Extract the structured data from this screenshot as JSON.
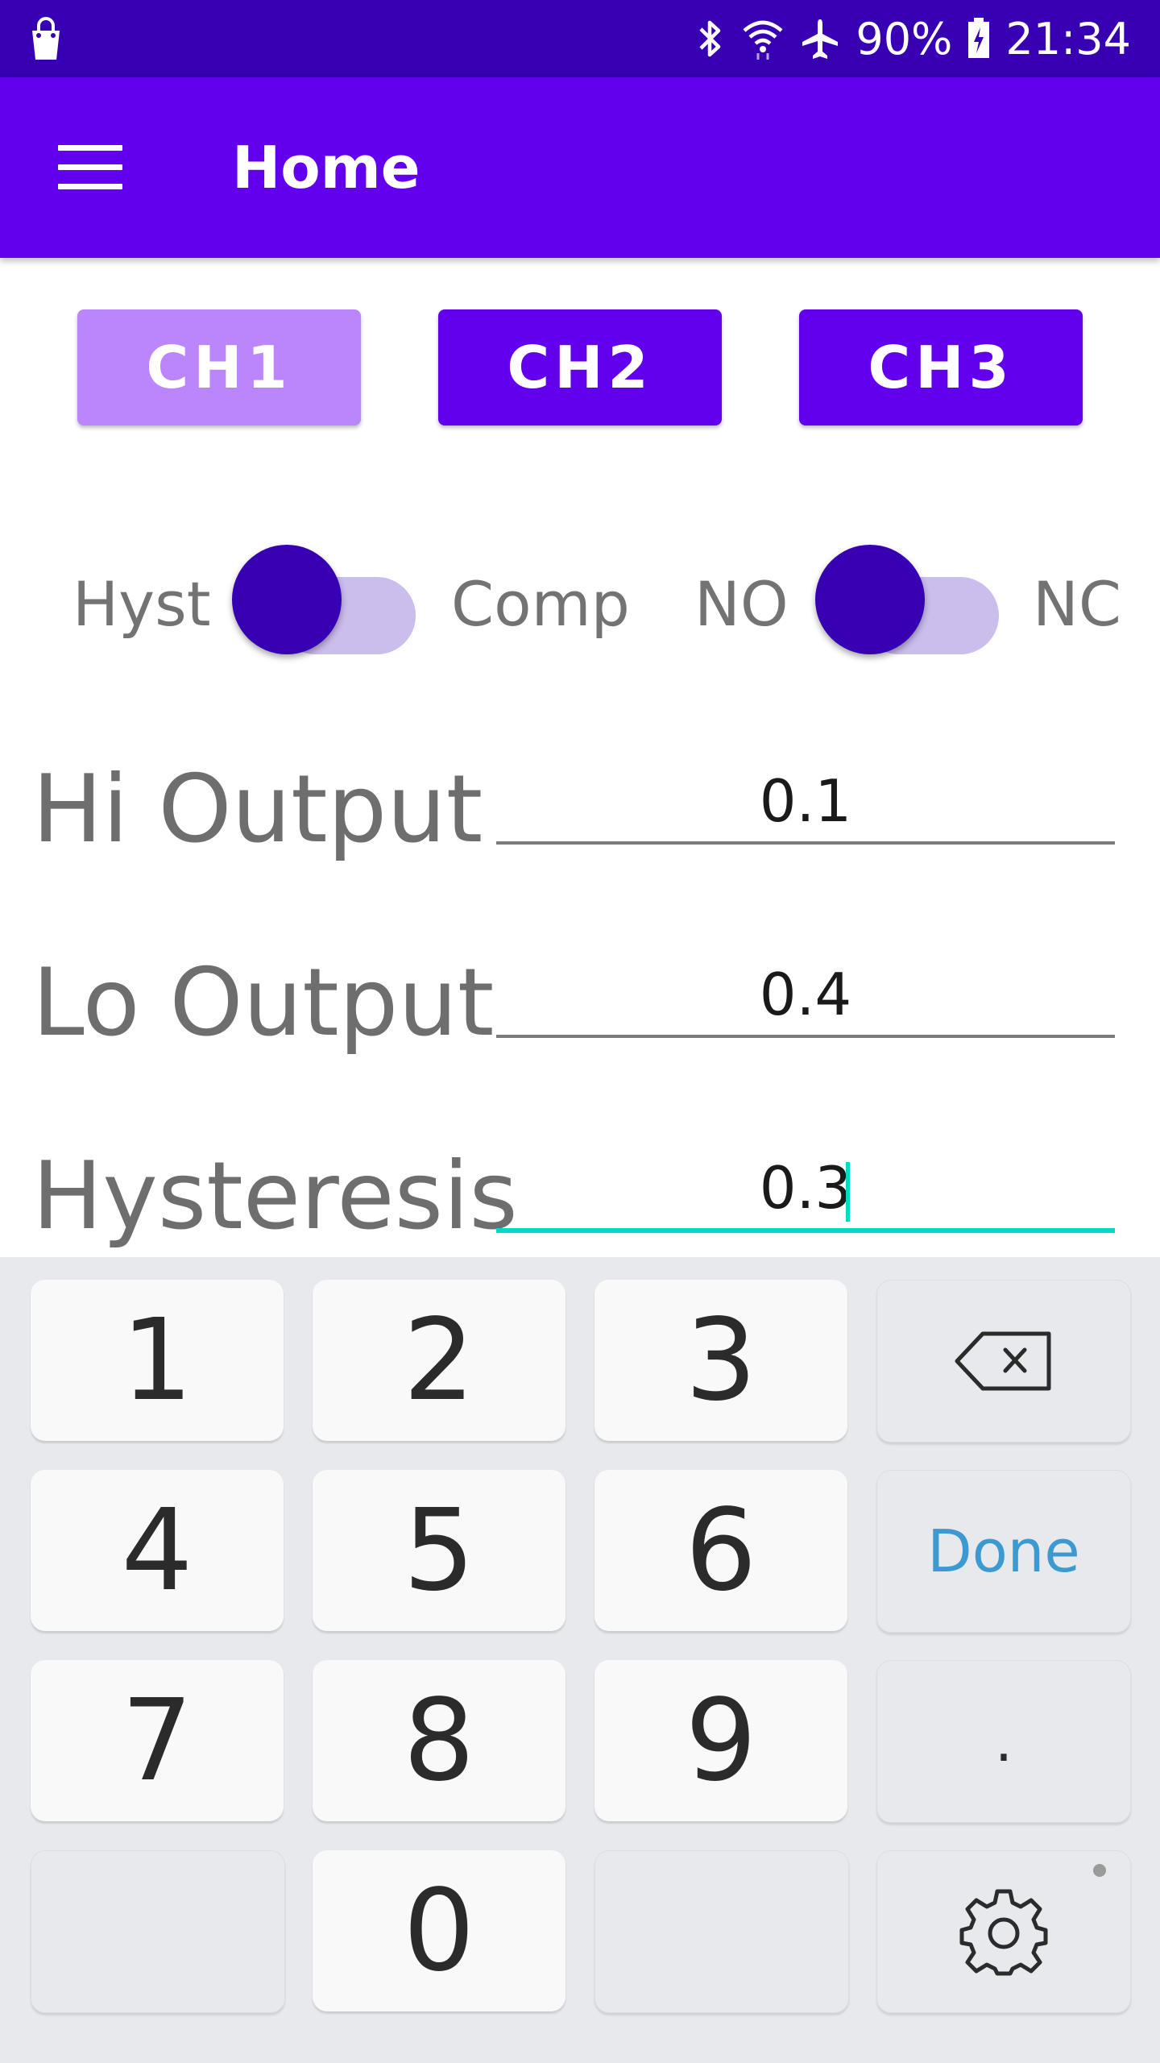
{
  "status_bar": {
    "battery": "90%",
    "time": "21:34",
    "icons": [
      "shopping-bag-icon",
      "bluetooth-icon",
      "wifi-icon",
      "airplane-icon",
      "battery-charging-icon"
    ]
  },
  "app_bar": {
    "menu_icon": "hamburger-menu-icon",
    "title": "Home"
  },
  "channels": [
    {
      "label": "CH1",
      "active": true
    },
    {
      "label": "CH2",
      "active": false
    },
    {
      "label": "CH3",
      "active": false
    }
  ],
  "switches": {
    "mode": {
      "left_label": "Hyst",
      "right_label": "Comp"
    },
    "contact": {
      "left_label": "NO",
      "right_label": "NC"
    }
  },
  "fields": [
    {
      "label": "Hi Output",
      "value": "0.1"
    },
    {
      "label": "Lo Output",
      "value": "0.4"
    },
    {
      "label": "Hysteresis",
      "value": "0.3",
      "focused": true
    }
  ],
  "keyboard": {
    "keys": [
      "1",
      "2",
      "3",
      "4",
      "5",
      "6",
      "7",
      "8",
      "9",
      "0"
    ],
    "done_label": "Done",
    "decimal_label": ".",
    "backspace_icon": "backspace-icon",
    "settings_icon": "settings-gear-icon"
  },
  "colors": {
    "primary": "#6200EE",
    "primary_dark": "#3700B3",
    "active_channel": "#BB86FC",
    "accent": "#03DAC6",
    "done_text": "#3D9AD1"
  }
}
